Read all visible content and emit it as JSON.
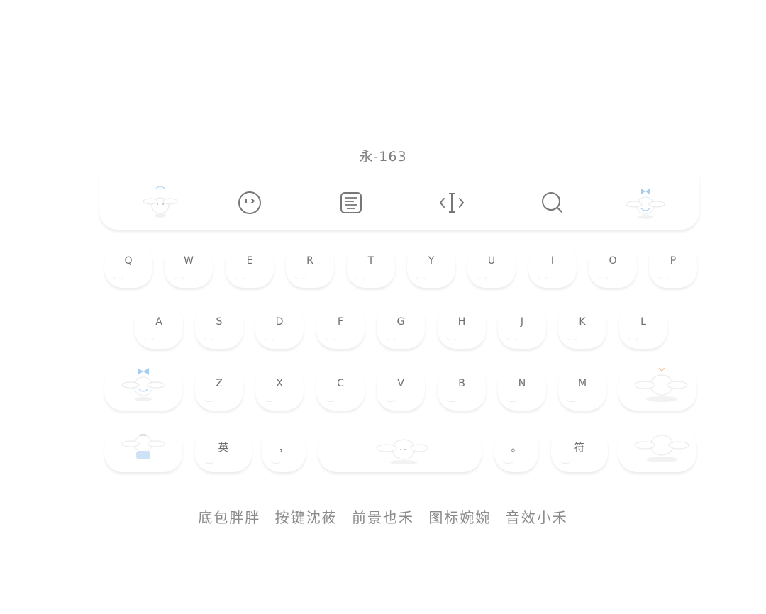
{
  "title": "永-163",
  "toolbar": {
    "icons": [
      "cinnamoroll-sticker-icon",
      "emoji-face-icon",
      "keyboard-icon",
      "cursor-icon",
      "search-icon",
      "cinnamoroll-bow-sticker-icon"
    ]
  },
  "keyboard": {
    "row1": [
      "Q",
      "W",
      "E",
      "R",
      "T",
      "Y",
      "U",
      "I",
      "O",
      "P"
    ],
    "row2": [
      "A",
      "S",
      "D",
      "F",
      "G",
      "H",
      "J",
      "K",
      "L"
    ],
    "row3": [
      "Z",
      "X",
      "C",
      "V",
      "B",
      "N",
      "M"
    ],
    "row4": {
      "lang": "英",
      "comma": "，",
      "period": "。",
      "symbols": "符"
    }
  },
  "credits": [
    "底包胖胖",
    "按键沈莜",
    "前景也禾",
    "图标婉婉",
    "音效小禾"
  ],
  "colors": {
    "text": "#6e6e6e",
    "accent_blue": "#a9cdf0",
    "accent_orange": "#f3c99a"
  }
}
